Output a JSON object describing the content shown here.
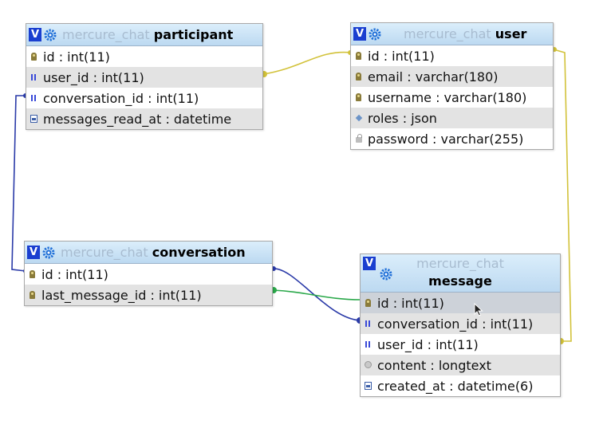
{
  "colors": {
    "header_bg": "#c7e0f4",
    "toggle_bg": "#1a3fd0",
    "db_text": "#a8bcd0",
    "rel_participant_user": "#d2c23a",
    "rel_conversation_participant": "#2a3aa8",
    "rel_message_conversation": "#2a3aa8",
    "rel_conversation_message": "#2aa84a",
    "rel_message_user": "#d2c23a"
  },
  "tables": {
    "participant": {
      "toggle": "V",
      "db": "mercure_chat",
      "name": "participant",
      "fields": [
        {
          "icon": "primary-key-icon",
          "text": "id : int(11)"
        },
        {
          "icon": "index-icon",
          "text": "user_id : int(11)"
        },
        {
          "icon": "index-icon",
          "text": "conversation_id : int(11)"
        },
        {
          "icon": "datetime-icon",
          "text": "messages_read_at : datetime"
        }
      ]
    },
    "user": {
      "toggle": "V",
      "db": "mercure_chat",
      "name": "user",
      "fields": [
        {
          "icon": "primary-key-icon",
          "text": "id : int(11)"
        },
        {
          "icon": "unique-key-icon",
          "text": "email : varchar(180)"
        },
        {
          "icon": "unique-key-icon",
          "text": "username : varchar(180)"
        },
        {
          "icon": "json-icon",
          "text": "roles : json"
        },
        {
          "icon": "field-icon",
          "text": "password : varchar(255)"
        }
      ]
    },
    "conversation": {
      "toggle": "V",
      "db": "mercure_chat",
      "name": "conversation",
      "fields": [
        {
          "icon": "primary-key-icon",
          "text": "id : int(11)"
        },
        {
          "icon": "unique-key-icon",
          "text": "last_message_id : int(11)"
        }
      ]
    },
    "message": {
      "toggle": "V",
      "db": "mercure_chat",
      "name": "message",
      "fields": [
        {
          "icon": "primary-key-icon",
          "text": "id : int(11)"
        },
        {
          "icon": "index-icon",
          "text": "conversation_id : int(11)"
        },
        {
          "icon": "index-icon",
          "text": "user_id : int(11)"
        },
        {
          "icon": "text-icon",
          "text": "content : longtext"
        },
        {
          "icon": "datetime-icon",
          "text": "created_at : datetime(6)"
        }
      ]
    }
  }
}
